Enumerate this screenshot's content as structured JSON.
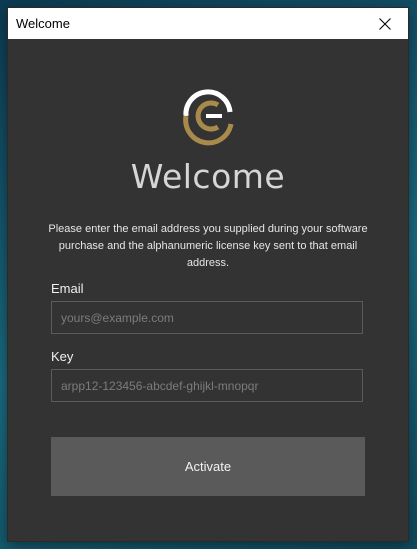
{
  "window": {
    "title": "Welcome",
    "close_icon": "close-icon"
  },
  "logo": {
    "icon": "company-logo-icon",
    "colors": {
      "gold": "#a88a4a",
      "white": "#ffffff"
    }
  },
  "heading": "Welcome",
  "instructions": "Please enter the email address you supplied during your software purchase and the alphanumeric license key sent to that email address.",
  "form": {
    "email_label": "Email",
    "email_placeholder": "yours@example.com",
    "email_value": "",
    "key_label": "Key",
    "key_placeholder": "arpp12-123456-abcdef-ghijkl-mnopqr",
    "key_value": ""
  },
  "activate_label": "Activate",
  "colors": {
    "window_bg": "#333333",
    "button_bg": "#5a5a5a",
    "input_border": "#5b5b5b"
  }
}
